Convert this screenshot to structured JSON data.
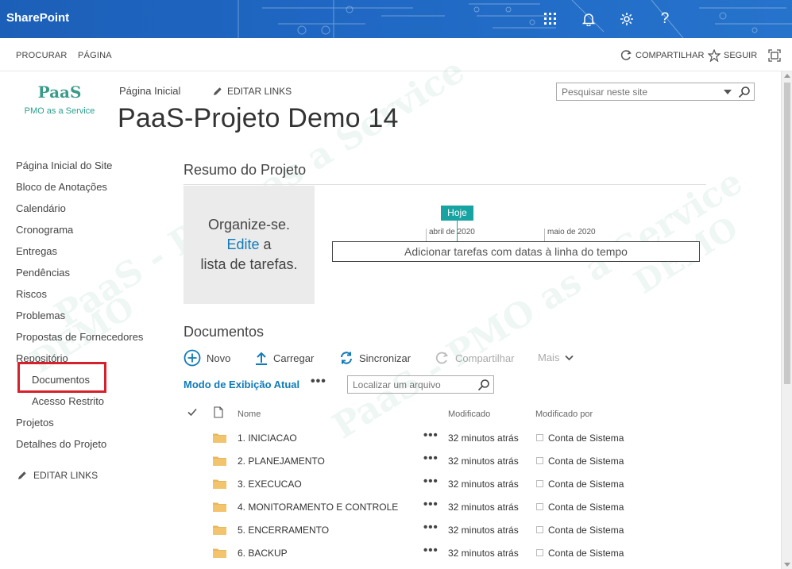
{
  "suitebar": {
    "brand": "SharePoint",
    "icons": [
      "app-launcher-icon",
      "bell-icon",
      "gear-icon",
      "help-icon"
    ],
    "help_label": "?"
  },
  "ribbon": {
    "tabs": [
      "PROCURAR",
      "PÁGINA"
    ],
    "share_label": "COMPARTILHAR",
    "follow_label": "SEGUIR"
  },
  "logo": {
    "title": "PaaS",
    "subtitle": "PMO as a Service"
  },
  "topnav": {
    "home": "Página Inicial",
    "edit_links": "EDITAR LINKS"
  },
  "site_title": "PaaS-Projeto Demo 14",
  "search": {
    "placeholder": "Pesquisar neste site"
  },
  "leftnav": {
    "items": [
      "Página Inicial do Site",
      "Bloco de Anotações",
      "Calendário",
      "Cronograma",
      "Entregas",
      "Pendências",
      "Riscos",
      "Problemas",
      "Propostas de Fornecedores",
      "Repositório",
      "Documentos",
      "Acesso Restrito",
      "Projetos",
      "Detalhes do Projeto"
    ],
    "edit_links": "EDITAR LINKS"
  },
  "summary": {
    "title": "Resumo do Projeto",
    "organize_line1": "Organize-se.",
    "organize_link": "Edite",
    "organize_line2_rest": " a",
    "organize_line3": "lista de tarefas.",
    "today_label": "Hoje",
    "months": [
      "abril de 2020",
      "maio de 2020"
    ],
    "timeline_text": "Adicionar tarefas com datas à linha do tempo"
  },
  "documents": {
    "title": "Documentos",
    "toolbar": {
      "new": "Novo",
      "upload": "Carregar",
      "sync": "Sincronizar",
      "share": "Compartilhar",
      "more": "Mais"
    },
    "view_label": "Modo de Exibição Atual",
    "view_more": "•••",
    "find_placeholder": "Localizar um arquivo",
    "columns": {
      "name": "Nome",
      "modified": "Modificado",
      "modified_by": "Modificado por"
    },
    "rows": [
      {
        "name": "1. INICIACAO",
        "modified": "32 minutos atrás",
        "by": "Conta de Sistema"
      },
      {
        "name": "2. PLANEJAMENTO",
        "modified": "32 minutos atrás",
        "by": "Conta de Sistema"
      },
      {
        "name": "3. EXECUCAO",
        "modified": "32 minutos atrás",
        "by": "Conta de Sistema"
      },
      {
        "name": "4. MONITORAMENTO E CONTROLE",
        "modified": "32 minutos atrás",
        "by": "Conta de Sistema"
      },
      {
        "name": "5. ENCERRAMENTO",
        "modified": "32 minutos atrás",
        "by": "Conta de Sistema"
      },
      {
        "name": "6. BACKUP",
        "modified": "32 minutos atrás",
        "by": "Conta de Sistema"
      }
    ],
    "row_menu": "•••"
  },
  "watermark": {
    "line1": "PaaS - PMO as a Service",
    "line2": "DEMO"
  },
  "colors": {
    "suitebar": "#1f67c2",
    "accent": "#0f7bb8",
    "today": "#17a3a2",
    "highlight": "#d6202c"
  }
}
